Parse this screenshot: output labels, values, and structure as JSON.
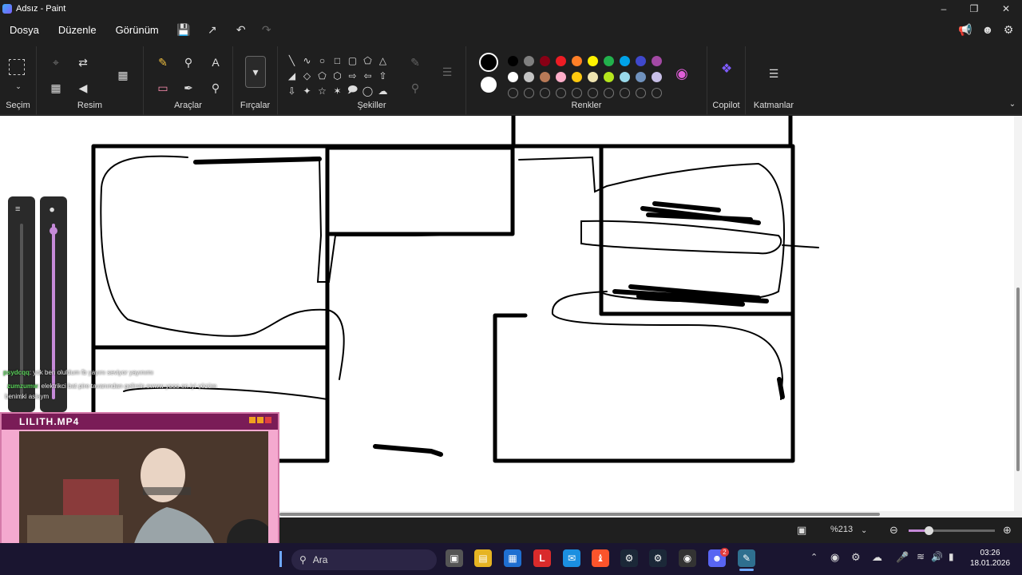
{
  "window": {
    "title": "Adsız - Paint"
  },
  "menu": {
    "file": "Dosya",
    "edit": "Düzenle",
    "view": "Görünüm"
  },
  "ribbon": {
    "groups": {
      "selection": "Seçim",
      "image": "Resim",
      "tools": "Araçlar",
      "brushes": "Fırçalar",
      "shapes": "Şekiller",
      "colors": "Renkler",
      "copilot": "Copilot",
      "layers": "Katmanlar"
    },
    "palette": [
      "#000000",
      "#7f7f7f",
      "#880015",
      "#ed1c24",
      "#ff7f27",
      "#fff200",
      "#22b14c",
      "#00a2e8",
      "#3f48cc",
      "#a349a4",
      "#ffffff",
      "#c3c3c3",
      "#b97a57",
      "#ffaec9",
      "#ffc90e",
      "#efe4b0",
      "#b5e61d",
      "#99d9ea",
      "#7092be",
      "#c8bfe7"
    ],
    "primary_color": "#000000",
    "secondary_color": "#ffffff"
  },
  "status": {
    "zoom": "%213"
  },
  "chat": [
    {
      "user": "psydcqq",
      "text": ": yok ben oluldum fb yayını seviyor yayınımı"
    },
    {
      "user": "zumzumw",
      "text": ": elektrikci bat pire tavanından gelirsin ewww yooo en iyi çözüm"
    },
    {
      "user": "",
      "text": "benimki aslaym"
    }
  ],
  "webcam": {
    "title": "LILITH.MP4"
  },
  "taskbar": {
    "search_placeholder": "Ara",
    "time": "03:26",
    "date": "18.01.2026",
    "discord_badge": "2"
  }
}
